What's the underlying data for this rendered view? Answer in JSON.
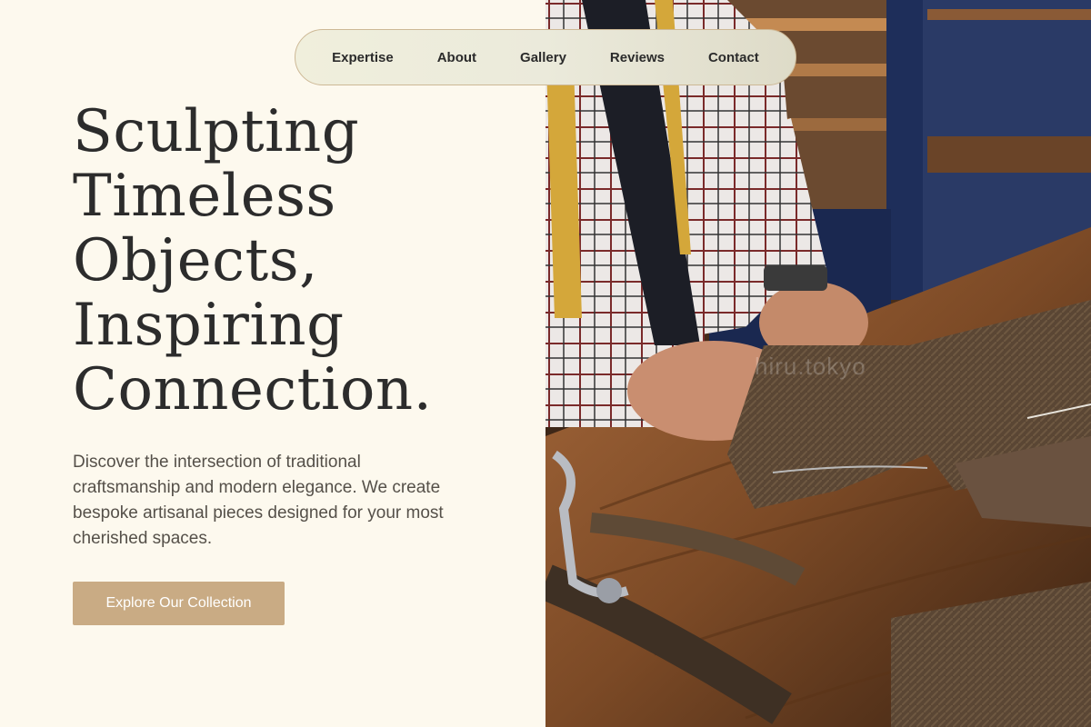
{
  "nav": {
    "items": [
      {
        "label": "Expertise"
      },
      {
        "label": "About"
      },
      {
        "label": "Gallery"
      },
      {
        "label": "Reviews"
      },
      {
        "label": "Contact"
      }
    ]
  },
  "hero": {
    "title_lines": [
      "Sculpting",
      "Timeless",
      "Objects,",
      "Inspiring",
      "Connection."
    ],
    "description": "Discover the intersection of traditional craftsmanship and modern elegance. We create bespoke artisanal pieces designed for your most cherished spaces.",
    "cta_label": "Explore Our Collection"
  },
  "photo": {
    "watermark": "hiru.tokyo"
  },
  "colors": {
    "background": "#fdf9ee",
    "accent": "#c9ab84",
    "heading": "#2c2c2c",
    "body_text": "#555049",
    "nav_border": "#cdb895"
  }
}
